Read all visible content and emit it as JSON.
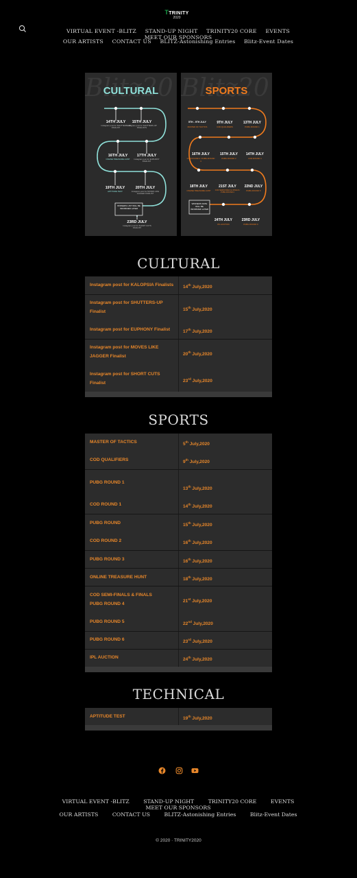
{
  "brand": {
    "name": "TRINITY",
    "year": "2020"
  },
  "nav": {
    "row1": [
      "VIRTUAL EVENT -BLITZ",
      "STAND-UP NIGHT",
      "TRINITY20 CORE",
      "EVENTS",
      "MEET OUR SPONSORS"
    ],
    "row2": [
      "OUR ARTISTS",
      "CONTACT US",
      "BLITZ-Astonishing Entries",
      "Blitz-Event Dates"
    ]
  },
  "posters": {
    "cultural": {
      "script": "Blitz20",
      "title": "CULTURAL",
      "accent": "#8fe0d9",
      "nodes": [
        {
          "date": "14TH JULY",
          "desc": "Instagram post for SHUTTERS-UP FINALIST"
        },
        {
          "date": "15TH JULY",
          "desc": "Instagram post for SHUTTERS-UP FINALISTS"
        },
        {
          "date": "16TH JULY",
          "desc": "ONLINE TREASURE HUNT"
        },
        {
          "date": "17TH JULY",
          "desc": "Instagram post for EUPHONY FINALIST"
        },
        {
          "date": "19TH JULY",
          "desc": "APTITUDE TEST"
        },
        {
          "date": "20TH JULY",
          "desc": "Instagram post for MOVES LIKE JAGGER FINALIST"
        },
        {
          "date": "",
          "desc": "WINNERS LIST WILL BE INFORMED LATER"
        },
        {
          "date": "23RD JULY",
          "desc": "Instagram post for SHORT CUTS FINALIST"
        }
      ]
    },
    "sports": {
      "script": "Blitz20",
      "title": "SPORTS",
      "accent": "#f07b1d",
      "nodes": [
        {
          "date": "5TH - 9TH JULY",
          "desc": "MASTER OF TACTICS"
        },
        {
          "date": "9TH JULY",
          "desc": "COD QUALIFIERS"
        },
        {
          "date": "13TH JULY",
          "desc": "PUBG ROUND 1"
        },
        {
          "date": "16TH JULY",
          "desc": "COD ROUND 2 / PUBG ROUND 3"
        },
        {
          "date": "15TH JULY",
          "desc": "PUBG ROUND 2"
        },
        {
          "date": "14TH JULY",
          "desc": "COD ROUND 1"
        },
        {
          "date": "18TH JULY",
          "desc": "ONLINE TREASURE HUNT"
        },
        {
          "date": "21ST JULY",
          "desc": "COD SEMI-FINALS & FINALS / PUBG ROUND 4"
        },
        {
          "date": "22ND JULY",
          "desc": "PUBG ROUND 5"
        },
        {
          "date": "",
          "desc": "WINNERS DATE WILL BE INFORMED LATER"
        },
        {
          "date": "24TH JULY",
          "desc": "IPL AUCTION"
        },
        {
          "date": "23RD JULY",
          "desc": "PUBG ROUND 6"
        }
      ]
    }
  },
  "sections": {
    "cultural": {
      "title": "CULTURAL",
      "rows": [
        {
          "event": "Instagram post for KALOPSIA Finalists",
          "day": "14",
          "suf": "th",
          "rest": " July,2020"
        },
        {
          "event": "Instagram post for SHUTTERS-UP Finalist",
          "day": "15",
          "suf": "th",
          "rest": " July,2020"
        },
        {
          "event": "Instagram post for EUPHONY Finalist",
          "day": "17",
          "suf": "th",
          "rest": " July,2020"
        },
        {
          "event": "Instagram post for MOVES LIKE JAGGER Finalist",
          "day": "20",
          "suf": "th",
          "rest": " July,2020"
        },
        {
          "event": "Instagram post for SHORT CUTS Finalist",
          "day": "23",
          "suf": "rd",
          "rest": " July,2020"
        }
      ]
    },
    "sports": {
      "title": "SPORTS",
      "rows": [
        {
          "event": "MASTER OF TACTICS",
          "day": "5",
          "suf": "th",
          "rest": " July,2020"
        },
        {
          "event": "COD QUALIFIERS",
          "day": "9",
          "suf": "th",
          "rest": " July,2020"
        },
        {
          "event": "PUBG ROUND 1",
          "day": "13",
          "suf": "th",
          "rest": " July,2020"
        },
        {
          "event": "COD ROUND 1",
          "day": "14",
          "suf": "th",
          "rest": " July,2020"
        },
        {
          "event": "PUBG ROUND",
          "day": "15",
          "suf": "th",
          "rest": " July,2020"
        },
        {
          "event": "COD ROUND 2",
          "day": "16",
          "suf": "th",
          "rest": " July,2020"
        },
        {
          "event": "PUBG ROUND 3",
          "day": "16",
          "suf": "th",
          "rest": " July,2020"
        },
        {
          "event": "ONLINE TREASURE HUNT",
          "day": "18",
          "suf": "th",
          "rest": " July,2020"
        },
        {
          "event": "COD SEMI-FINALS & FINALS PUBG ROUND 4",
          "day": "21",
          "suf": "st",
          "rest": " July,2020"
        },
        {
          "event": "PUBG ROUND 5",
          "day": "22",
          "suf": "nd",
          "rest": " July,2020"
        },
        {
          "event": "PUBG ROUND 6",
          "day": "23",
          "suf": "rd",
          "rest": " July,2020"
        },
        {
          "event": "IPL AUCTION",
          "day": "24",
          "suf": "th",
          "rest": " July,2020"
        }
      ]
    },
    "technical": {
      "title": "TECHNICAL",
      "rows": [
        {
          "event": "APTITUDE TEST",
          "day": "19",
          "suf": "th",
          "rest": " July,2020"
        }
      ]
    }
  },
  "social": [
    {
      "icon": "facebook-icon",
      "color": "#e8872a"
    },
    {
      "icon": "instagram-icon",
      "color": "#e8872a"
    },
    {
      "icon": "youtube-icon",
      "color": "#e8872a"
    }
  ],
  "footer": {
    "row1": [
      "VIRTUAL EVENT -BLITZ",
      "STAND-UP NIGHT",
      "TRINITY20 CORE",
      "EVENTS",
      "MEET OUR SPONSORS"
    ],
    "row2": [
      "OUR ARTISTS",
      "CONTACT US",
      "BLITZ-Astonishing Entries",
      "Blitz-Event Dates"
    ],
    "copyright": "© 2020 · TRINITY2020"
  }
}
